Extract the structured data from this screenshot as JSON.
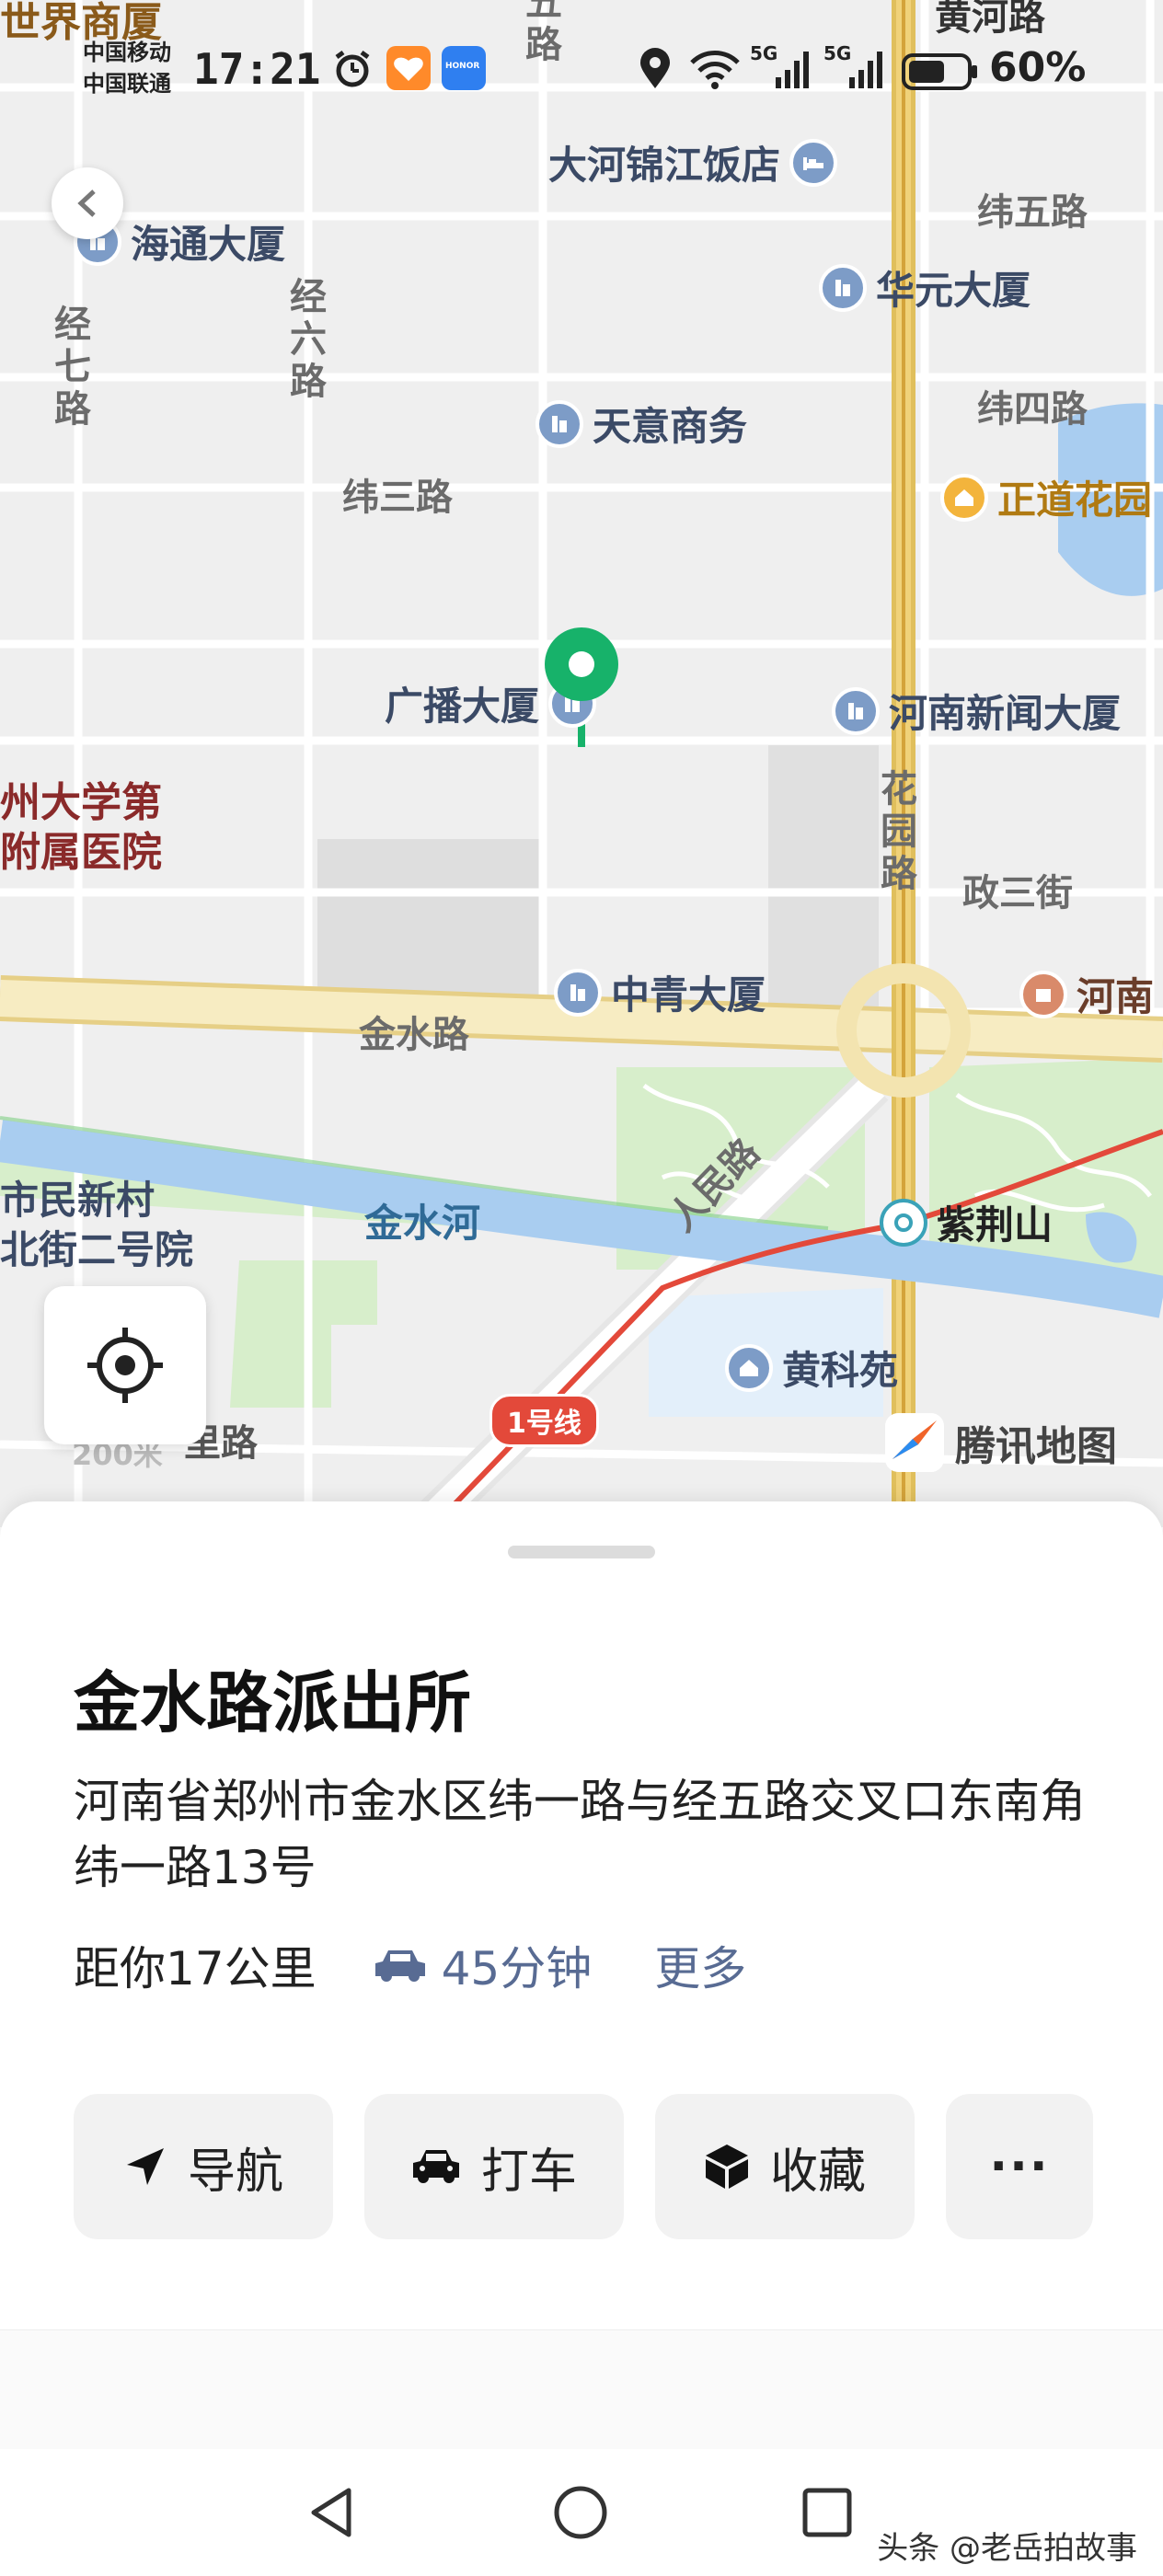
{
  "status_bar": {
    "carrier_1": "中国移动",
    "carrier_2": "中国联通",
    "time": "17:21",
    "battery": "60%",
    "icons": [
      "alarm-icon",
      "heart-app-icon",
      "honor-app-icon",
      "location-icon",
      "wifi-icon",
      "signal-5g-icon",
      "signal-5g-icon",
      "battery-icon"
    ],
    "honor_badge": "HONOR",
    "signal_tag": "5G"
  },
  "map": {
    "streets": {
      "shijie_top": "世界商厦",
      "wu_road": "五\n路",
      "huanghe_road": "黄河路",
      "weiwu": "纬五路",
      "weisi": "纬四路",
      "weisan": "纬三路",
      "jingqi": "经\n七\n路",
      "jingliu": "经\n六\n路",
      "huayuan": "花\n园\n路",
      "zhengsan": "政三街",
      "jinshui": "金水路",
      "renmin": "人民路",
      "bottom_road": "里路",
      "bottom_road_prefix": "200米"
    },
    "pois": {
      "dahe_hotel": "大河锦江饭店",
      "haitong": "海通大厦",
      "huayuan_bld": "华元大厦",
      "tianyi": "天意商务",
      "zhengdao": "正道花园",
      "guangbo": "广播大厦",
      "henan_news": "河南新闻大厦",
      "zhongqing": "中青大厦",
      "henan_right": "河南",
      "zijingshan": "紫荆山",
      "huangkeyuan": "黄科苑"
    },
    "red_labels": {
      "hospital_line1": "州大学第",
      "hospital_line2": "附属医院",
      "residence_line1": "市民新村",
      "residence_line2": "北街二号院"
    },
    "water": {
      "river": "金水河"
    },
    "metro_line": "1号线",
    "logo_text": "腾讯地图",
    "colors": {
      "road_main": "#f5e7b5",
      "road_main_edge": "#e6cf86",
      "road_minor": "#ffffff",
      "river": "#a9cdf0",
      "park": "#d7eecb",
      "pin": "#17b26a",
      "metro": "#e3493a",
      "subway_road": "#d6a63a"
    }
  },
  "sheet": {
    "title": "金水路派出所",
    "address": "河南省郑州市金水区纬一路与经五路交叉口东南角 纬一路13号",
    "distance": "距你17公里",
    "drive_time": "45分钟",
    "more": "更多",
    "actions": [
      {
        "icon": "navigate-arrow-icon",
        "label": "导航"
      },
      {
        "icon": "taxi-icon",
        "label": "打车"
      },
      {
        "icon": "favorite-box-icon",
        "label": "收藏"
      },
      {
        "icon": "more-dots-icon",
        "label": "···"
      }
    ]
  },
  "nav_bar": {
    "icons": [
      "back-triangle-icon",
      "home-circle-icon",
      "recents-square-icon"
    ],
    "watermark": "头条 @老岳拍故事"
  }
}
